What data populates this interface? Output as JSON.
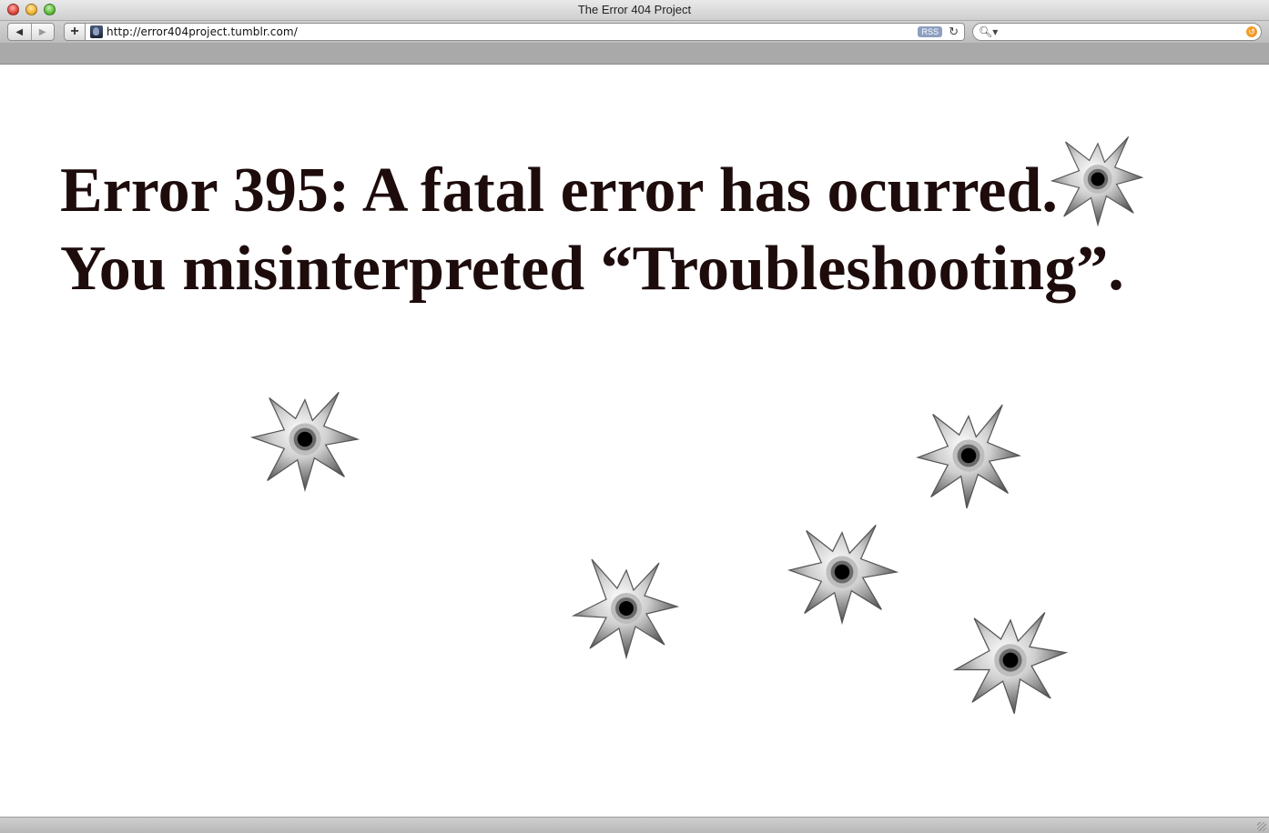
{
  "window": {
    "title": "The Error 404 Project"
  },
  "toolbar": {
    "url": "http://error404project.tumblr.com/",
    "rss_label": "RSS"
  },
  "page": {
    "headline_line1": "Error 395: A fatal error has ocurred.",
    "headline_line2": "You misinterpreted “Troubleshooting”."
  },
  "colors": {
    "headline": "#1e0c0c",
    "background": "#ffffff"
  }
}
